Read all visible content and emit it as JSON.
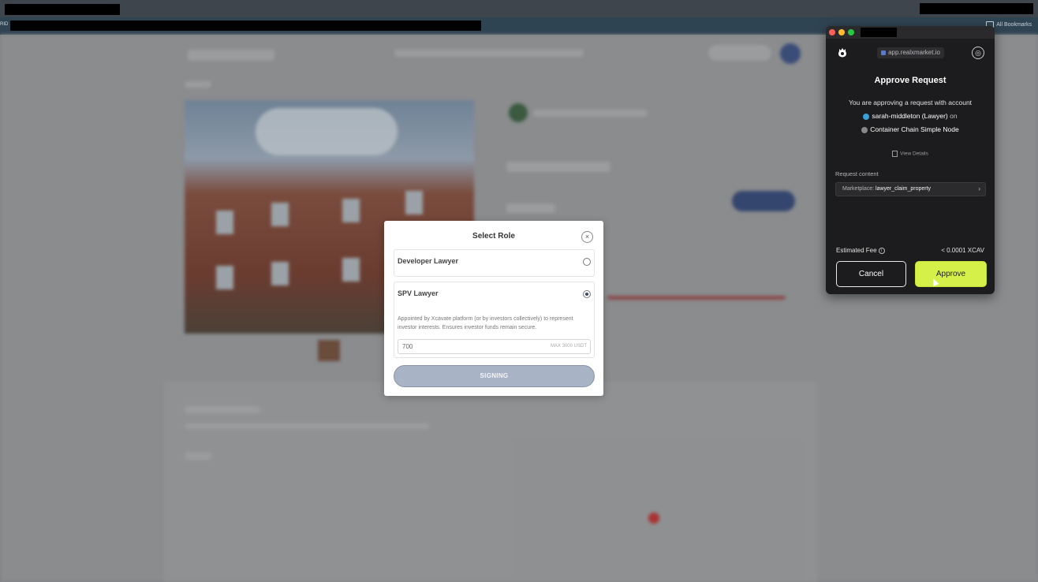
{
  "browser": {
    "bookmarks_all_label": "All Bookmarks",
    "partial_left_label": "RID"
  },
  "select_role_modal": {
    "title": "Select Role",
    "close_symbol": "×",
    "roles": [
      {
        "name": "Developer Lawyer",
        "selected": false
      },
      {
        "name": "SPV Lawyer",
        "selected": true,
        "description": "Appointed by Xcavate platform (or by investors collectively) to represent investor interests. Ensures investor funds remain secure.",
        "amount_value": "700",
        "amount_max": "MAX 3000 USDT"
      }
    ],
    "submit_label": "SIGNING"
  },
  "wallet": {
    "url": "app.realxmarket.io",
    "heading": "Approve Request",
    "subtitle": "You are approving a request with account",
    "account": "sarah-middleton (Lawyer)",
    "account_suffix": "on",
    "chain": "Container Chain Simple Node",
    "view_details": "View Details",
    "request_content_label": "Request content",
    "request_prefix": "Marketplace:",
    "request_value": "lawyer_claim_property",
    "fee_label": "Estimated Fee",
    "fee_value": "< 0.0001 XCAV",
    "cancel_label": "Cancel",
    "approve_label": "Approve",
    "colors": {
      "approve": "#d6f04a",
      "background": "#1c1c1e"
    }
  }
}
